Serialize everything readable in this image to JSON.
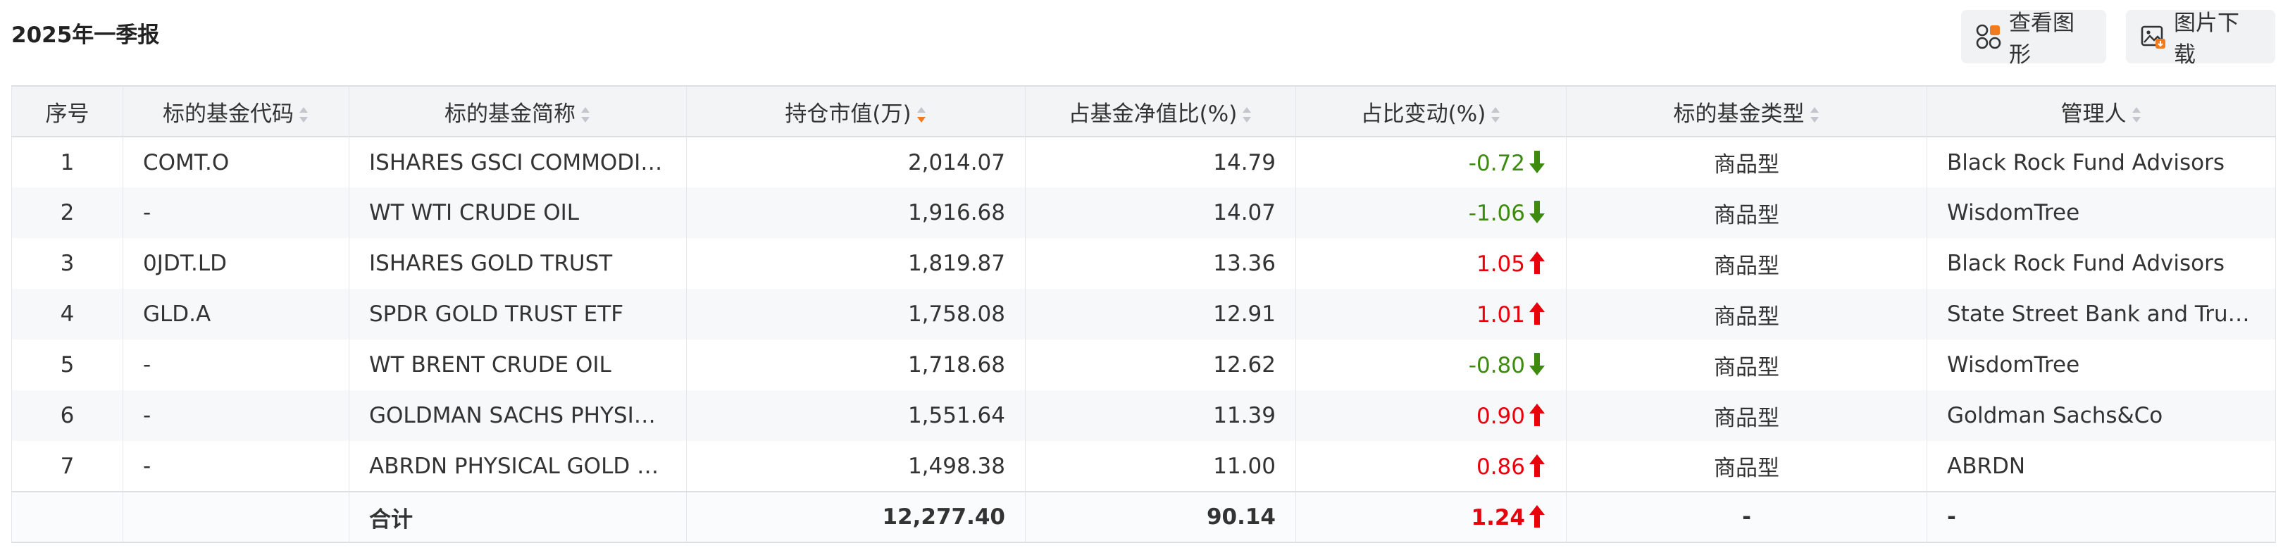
{
  "report": {
    "title": "2025年一季报"
  },
  "toolbar": {
    "view_chart_label": "查看图形",
    "download_image_label": "图片下载"
  },
  "colors": {
    "positive": "#e8000b",
    "negative": "#3d8b0e",
    "sort_active": "#f07a1e"
  },
  "table": {
    "columns": [
      "序号",
      "标的基金代码",
      "标的基金简称",
      "持仓市值(万)",
      "占基金净值比(%)",
      "占比变动(%)",
      "标的基金类型",
      "管理人"
    ],
    "sorted_column": "持仓市值(万)",
    "sort_direction": "desc",
    "rows": [
      {
        "no": "1",
        "code": "COMT.O",
        "name": "ISHARES GSCI COMMODITY DYNAMIC ROLL STRATEGY ETF",
        "value": "2,014.07",
        "ratio": "14.79",
        "change": "-0.72",
        "direction": "down",
        "type": "商品型",
        "manager": "Black Rock Fund Advisors"
      },
      {
        "no": "2",
        "code": "-",
        "name": "WT WTI CRUDE OIL",
        "value": "1,916.68",
        "ratio": "14.07",
        "change": "-1.06",
        "direction": "down",
        "type": "商品型",
        "manager": "WisdomTree"
      },
      {
        "no": "3",
        "code": "0JDT.LD",
        "name": "ISHARES GOLD TRUST",
        "value": "1,819.87",
        "ratio": "13.36",
        "change": "1.05",
        "direction": "up",
        "type": "商品型",
        "manager": "Black Rock Fund Advisors"
      },
      {
        "no": "4",
        "code": "GLD.A",
        "name": "SPDR GOLD TRUST ETF",
        "value": "1,758.08",
        "ratio": "12.91",
        "change": "1.01",
        "direction": "up",
        "type": "商品型",
        "manager": "State Street Bank and Trust Company"
      },
      {
        "no": "5",
        "code": "-",
        "name": "WT BRENT CRUDE OIL",
        "value": "1,718.68",
        "ratio": "12.62",
        "change": "-0.80",
        "direction": "down",
        "type": "商品型",
        "manager": "WisdomTree"
      },
      {
        "no": "6",
        "code": "-",
        "name": "GOLDMAN SACHS PHYSICAL GOLD ETF",
        "value": "1,551.64",
        "ratio": "11.39",
        "change": "0.90",
        "direction": "up",
        "type": "商品型",
        "manager": "Goldman Sachs&Co"
      },
      {
        "no": "7",
        "code": "-",
        "name": "ABRDN PHYSICAL GOLD SHARES ETF",
        "value": "1,498.38",
        "ratio": "11.00",
        "change": "0.86",
        "direction": "up",
        "type": "商品型",
        "manager": "ABRDN"
      }
    ],
    "total": {
      "label": "合计",
      "value": "12,277.40",
      "ratio": "90.14",
      "change": "1.24",
      "direction": "up",
      "type": "-",
      "manager": "-"
    }
  }
}
